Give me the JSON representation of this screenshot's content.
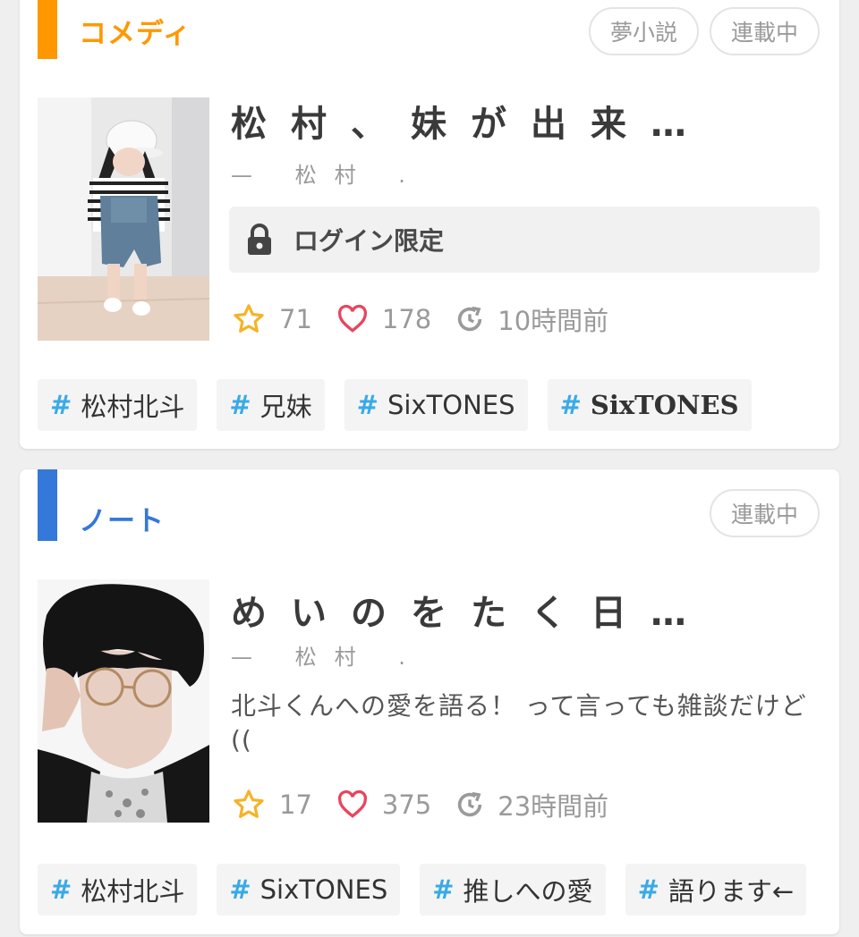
{
  "colors": {
    "comedy_accent": "#ff9800",
    "note_accent": "#3478d9",
    "star": "#f5b325",
    "heart": "#e8455e",
    "hash": "#3aaae6"
  },
  "cards": [
    {
      "category": "コメディ",
      "badges": [
        "夢小説",
        "連載中"
      ],
      "title": "松村、妹が出来…",
      "author": "— 松村 .",
      "lock_text": "ログイン限定",
      "lock_icon": "lock-icon",
      "stars": "71",
      "hearts": "178",
      "updated": "10時間前",
      "tags": [
        "松村北斗",
        "兄妹",
        "SixTONES",
        "SixTONES"
      ]
    },
    {
      "category": "ノート",
      "badges": [
        "連載中"
      ],
      "title": "めいのをたく日…",
      "author": "— 松村 .",
      "description": "北斗くんへの愛を語る！ って言っても雑談だけど((",
      "stars": "17",
      "hearts": "375",
      "updated": "23時間前",
      "tags": [
        "松村北斗",
        "SixTONES",
        "推しへの愛",
        "語ります←"
      ]
    }
  ]
}
